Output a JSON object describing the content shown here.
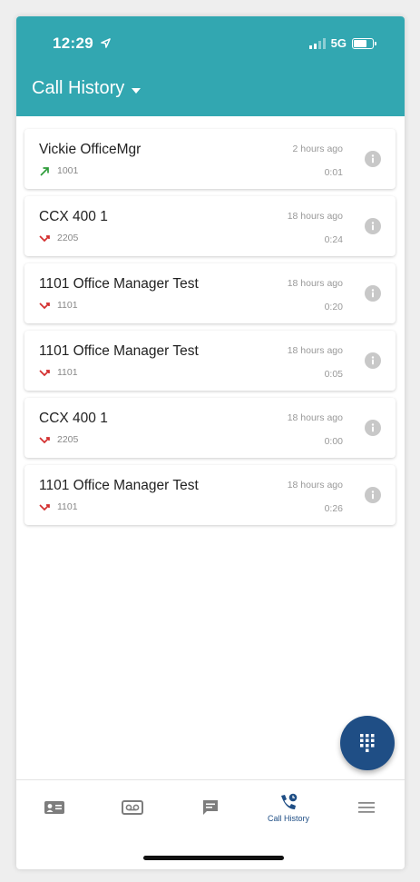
{
  "status_bar": {
    "time": "12:29",
    "network": "5G",
    "location_icon": "location-arrow-icon"
  },
  "header": {
    "title": "Call History"
  },
  "colors": {
    "appbar": "#32a7b1",
    "accent": "#1f4e85",
    "outgoing": "#2e9c3a",
    "missed": "#d32f2f"
  },
  "calls": [
    {
      "name": "Vickie OfficeMgr",
      "number": "1001",
      "when": "2 hours ago",
      "duration": "0:01",
      "direction": "outgoing"
    },
    {
      "name": "CCX 400 1",
      "number": "2205",
      "when": "18 hours ago",
      "duration": "0:24",
      "direction": "missed"
    },
    {
      "name": "1101 Office Manager Test",
      "number": "1101",
      "when": "18 hours ago",
      "duration": "0:20",
      "direction": "missed"
    },
    {
      "name": "1101 Office Manager Test",
      "number": "1101",
      "when": "18 hours ago",
      "duration": "0:05",
      "direction": "missed"
    },
    {
      "name": "CCX 400 1",
      "number": "2205",
      "when": "18 hours ago",
      "duration": "0:00",
      "direction": "missed"
    },
    {
      "name": "1101 Office Manager Test",
      "number": "1101",
      "when": "18 hours ago",
      "duration": "0:26",
      "direction": "missed"
    }
  ],
  "bottom_nav": {
    "items": [
      {
        "icon": "contacts-icon",
        "label": ""
      },
      {
        "icon": "voicemail-icon",
        "label": ""
      },
      {
        "icon": "messages-icon",
        "label": ""
      },
      {
        "icon": "call-history-icon",
        "label": "Call History"
      },
      {
        "icon": "menu-icon",
        "label": ""
      }
    ]
  }
}
